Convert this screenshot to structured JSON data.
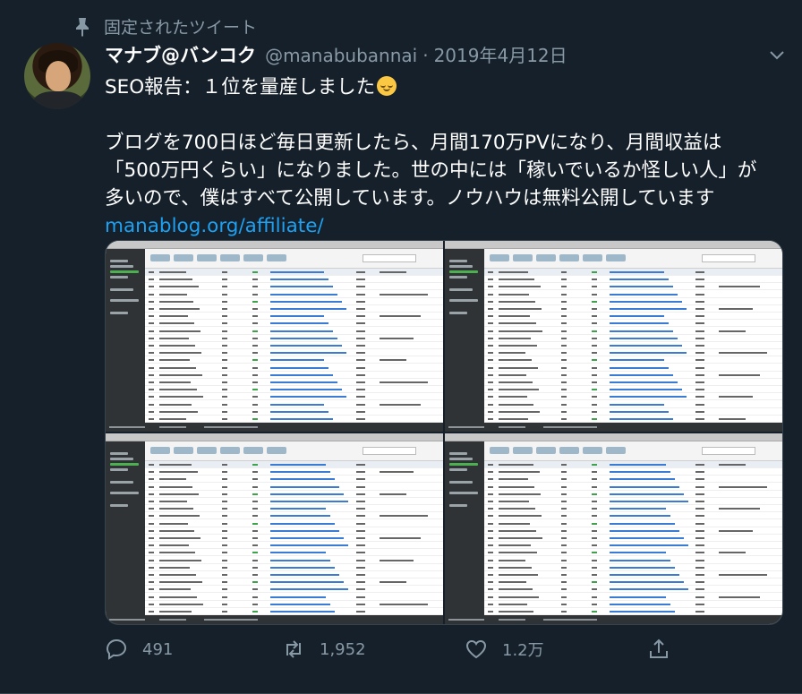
{
  "pinned": {
    "label": "固定されたツイート",
    "icon": "pin-icon"
  },
  "author": {
    "name": "マナブ@バンコク",
    "handle": "@manabubannai",
    "separator": "·",
    "date": "2019年4月12日"
  },
  "tweet": {
    "line1": "SEO報告：１位を量産しました",
    "emoji": "relieved-face-emoji",
    "line2": "ブログを700日ほど毎日更新したら、月間170万PVになり、月間収益は",
    "line3": "「500万円くらい」になりました。世の中には「稼いでいるか怪しい人」が",
    "line4": "多いので、僕はすべて公開しています。ノウハウは無料公開しています",
    "link": "manablog.org/affiliate/"
  },
  "media": {
    "count": 4,
    "description_icon": "rank-tracker-screenshot"
  },
  "actions": {
    "reply": {
      "icon": "reply-icon",
      "count": "491"
    },
    "retweet": {
      "icon": "retweet-icon",
      "count": "1,952"
    },
    "like": {
      "icon": "heart-icon",
      "count": "1.2万"
    },
    "share": {
      "icon": "share-icon",
      "count": ""
    }
  },
  "colors": {
    "background": "#15202b",
    "secondary_text": "#8899a6",
    "link": "#1da1f2"
  }
}
